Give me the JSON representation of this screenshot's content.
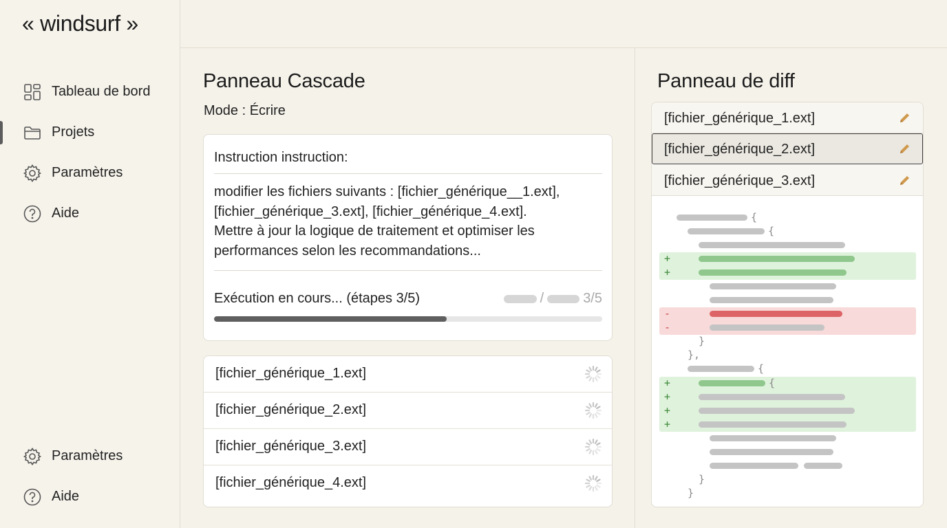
{
  "app": {
    "logo": "« windsurf »"
  },
  "sidebar": {
    "items": [
      {
        "label": "Tableau de bord",
        "icon": "dashboard-icon"
      },
      {
        "label": "Projets",
        "icon": "folder-icon",
        "active": true
      },
      {
        "label": "Paramètres",
        "icon": "gear-icon"
      },
      {
        "label": "Aide",
        "icon": "help-icon"
      }
    ],
    "bottom_items": [
      {
        "label": "Paramètres",
        "icon": "gear-icon"
      },
      {
        "label": "Aide",
        "icon": "help-icon"
      }
    ]
  },
  "cascade": {
    "title": "Panneau Cascade",
    "mode_label": "Mode : ",
    "mode_value": "Écrire",
    "instruction_prefix": "Instruction ",
    "instruction_label": "instruction:",
    "instruction_lines": [
      "modifier les fichiers suivants : [fichier_générique__1.ext],",
      "[fichier_générique_3.ext], [fichier_générique_4.ext].",
      "Mettre à jour la logique de traitement et optimiser les",
      "performances selon les recommandations..."
    ],
    "status": "Exécution en cours... (étapes 3/5)",
    "step_sep": "/",
    "step_count": "3/5",
    "progress": 0.6,
    "files": [
      "[fichier_générique_1.ext]",
      "[fichier_générique_2.ext]",
      "[fichier_générique_3.ext]",
      "[fichier_générique_4.ext]"
    ]
  },
  "diff": {
    "title": "Panneau de diff",
    "tabs": [
      {
        "label": "[fichier_générique_1.ext]",
        "active": false
      },
      {
        "label": "[fichier_générique_2.ext]",
        "active": true
      },
      {
        "label": "[fichier_générique_3.ext]",
        "active": false
      }
    ],
    "add_sign": "+",
    "del_sign": "-",
    "colors": {
      "added": "#8fc78c",
      "removed": "#dd6466",
      "placeholder": "#c4c4c4",
      "edit": "#d09a4e"
    }
  }
}
